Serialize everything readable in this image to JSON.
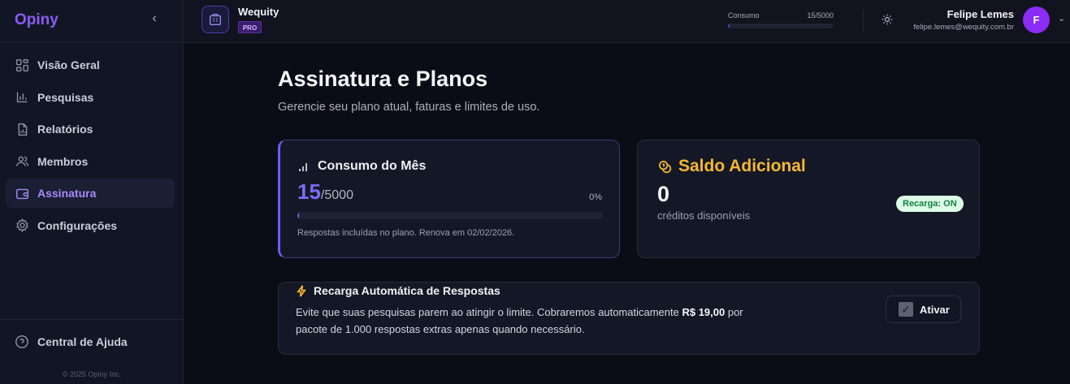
{
  "sidebar": {
    "brand": "Opiny",
    "items": [
      {
        "label": "Visão Geral",
        "icon": "grid-icon"
      },
      {
        "label": "Pesquisas",
        "icon": "bar-chart-icon"
      },
      {
        "label": "Relatórios",
        "icon": "file-chart-icon"
      },
      {
        "label": "Membros",
        "icon": "users-icon"
      },
      {
        "label": "Assinatura",
        "icon": "wallet-icon",
        "active": true
      },
      {
        "label": "Configurações",
        "icon": "gear-icon"
      }
    ],
    "help": "Central de Ajuda",
    "copyright": "© 2025 Opiny Inc."
  },
  "topbar": {
    "org_name": "Wequity",
    "plan_badge": "PRO",
    "usage_label": "Consumo",
    "usage_value": "15/5000",
    "usage_fraction": 0.003,
    "user_name": "Felipe Lemes",
    "user_email": "felipe.lemes@wequity.com.br",
    "avatar_initial": "F"
  },
  "page": {
    "title": "Assinatura e Planos",
    "subtitle": "Gerencie seu plano atual, faturas e limites de uso."
  },
  "consumo": {
    "title": "Consumo do Mês",
    "used": "15",
    "limit": "/5000",
    "percent": "0%",
    "fraction": 0.003,
    "note": "Respostas incluídas no plano. Renova em 02/02/2026."
  },
  "saldo": {
    "title": "Saldo Adicional",
    "value": "0",
    "label": "créditos disponíveis",
    "badge": "Recarga: ON"
  },
  "recarga": {
    "title": "Recarga Automática de Respostas",
    "desc_before": "Evite que suas pesquisas parem ao atingir o limite. Cobraremos automaticamente ",
    "desc_price": "R$ 19,00",
    "desc_after": " por pacote de 1.000 respostas extras apenas quando necessário.",
    "button_label": "Ativar",
    "checked": true
  },
  "colors": {
    "accent": "#8b5cf6",
    "progress": "#6d5ef5",
    "gold": "#f5b82e",
    "badge_bg": "#dcfce7",
    "badge_text": "#15803d"
  }
}
